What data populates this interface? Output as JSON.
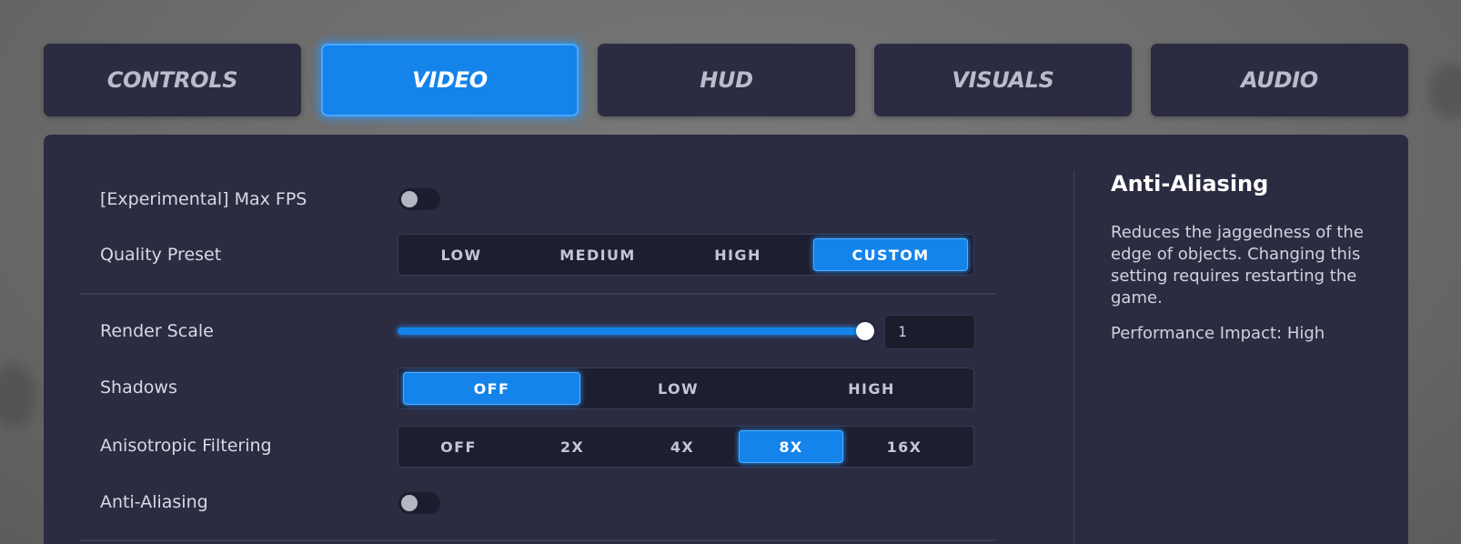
{
  "tabs": [
    {
      "label": "CONTROLS",
      "active": false
    },
    {
      "label": "VIDEO",
      "active": true
    },
    {
      "label": "HUD",
      "active": false
    },
    {
      "label": "VISUALS",
      "active": false
    },
    {
      "label": "AUDIO",
      "active": false
    }
  ],
  "settings": {
    "max_fps": {
      "label": "[Experimental] Max FPS",
      "enabled": false
    },
    "quality_preset": {
      "label": "Quality Preset",
      "options": [
        "LOW",
        "MEDIUM",
        "HIGH",
        "CUSTOM"
      ],
      "selected": "CUSTOM"
    },
    "render_scale": {
      "label": "Render Scale",
      "value": "1",
      "fill_fraction": 1.0
    },
    "shadows": {
      "label": "Shadows",
      "options": [
        "OFF",
        "LOW",
        "HIGH"
      ],
      "selected": "OFF"
    },
    "anisotropic": {
      "label": "Anisotropic Filtering",
      "options": [
        "OFF",
        "2X",
        "4X",
        "8X",
        "16X"
      ],
      "selected": "8X"
    },
    "anti_aliasing": {
      "label": "Anti-Aliasing",
      "enabled": false
    }
  },
  "info": {
    "title": "Anti-Aliasing",
    "description": "Reduces the jaggedness of the edge of objects. Changing this setting requires restarting the game.",
    "impact": "Performance Impact: High"
  },
  "colors": {
    "accent": "#1483ea",
    "panel": "#2b2c42",
    "background": "#6e6e6e"
  }
}
